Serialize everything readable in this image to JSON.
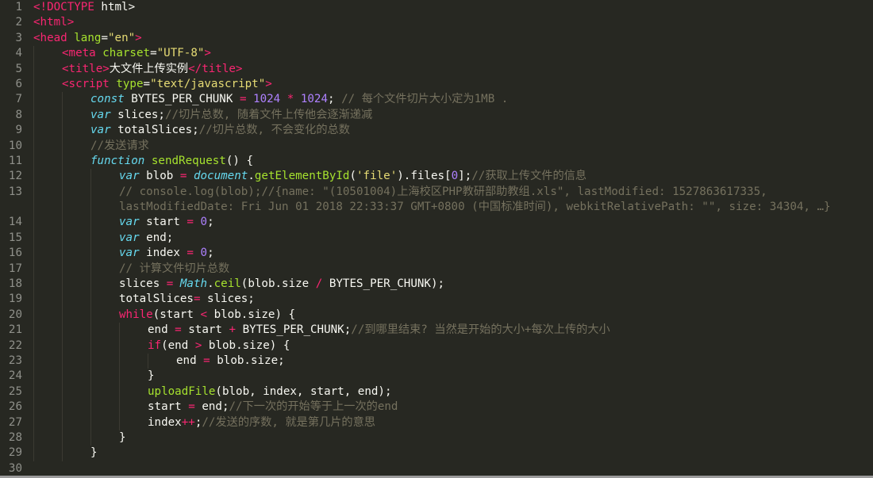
{
  "editor": {
    "lines": [
      {
        "n": "1",
        "indent": 0,
        "t": [
          [
            "tag",
            "<!DOCTYPE"
          ],
          [
            "plain",
            " html>"
          ]
        ]
      },
      {
        "n": "2",
        "indent": 0,
        "t": [
          [
            "tag",
            "<html>"
          ]
        ]
      },
      {
        "n": "3",
        "indent": 0,
        "t": [
          [
            "tag",
            "<head"
          ],
          [
            "attr",
            " lang"
          ],
          [
            "plain",
            "="
          ],
          [
            "str",
            "\"en\""
          ],
          [
            "tag",
            ">"
          ]
        ]
      },
      {
        "n": "4",
        "indent": 1,
        "t": [
          [
            "tag",
            "<meta"
          ],
          [
            "attr",
            " charset"
          ],
          [
            "plain",
            "="
          ],
          [
            "str",
            "\"UTF-8\""
          ],
          [
            "tag",
            ">"
          ]
        ]
      },
      {
        "n": "5",
        "indent": 1,
        "t": [
          [
            "tag",
            "<title>"
          ],
          [
            "plain",
            "大文件上传实例"
          ],
          [
            "tag",
            "</title>"
          ]
        ]
      },
      {
        "n": "6",
        "indent": 1,
        "t": [
          [
            "tag",
            "<script"
          ],
          [
            "attr",
            " type"
          ],
          [
            "plain",
            "="
          ],
          [
            "str",
            "\"text/javascript\""
          ],
          [
            "tag",
            ">"
          ]
        ]
      },
      {
        "n": "7",
        "indent": 2,
        "t": [
          [
            "kw",
            "const"
          ],
          [
            "plain",
            " BYTES_PER_CHUNK "
          ],
          [
            "op",
            "="
          ],
          [
            "plain",
            " "
          ],
          [
            "num",
            "1024"
          ],
          [
            "plain",
            " "
          ],
          [
            "op",
            "*"
          ],
          [
            "plain",
            " "
          ],
          [
            "num",
            "1024"
          ],
          [
            "plain",
            "; "
          ],
          [
            "cmt",
            "// 每个文件切片大小定为1MB ."
          ]
        ]
      },
      {
        "n": "8",
        "indent": 2,
        "t": [
          [
            "kw",
            "var"
          ],
          [
            "plain",
            " slices;"
          ],
          [
            "cmt",
            "//切片总数, 随着文件上传他会逐渐递减"
          ]
        ]
      },
      {
        "n": "9",
        "indent": 2,
        "t": [
          [
            "kw",
            "var"
          ],
          [
            "plain",
            " totalSlices;"
          ],
          [
            "cmt",
            "//切片总数, 不会变化的总数"
          ]
        ]
      },
      {
        "n": "10",
        "indent": 2,
        "t": [
          [
            "cmt",
            "//发送请求"
          ]
        ]
      },
      {
        "n": "11",
        "indent": 2,
        "t": [
          [
            "kw",
            "function"
          ],
          [
            "plain",
            " "
          ],
          [
            "fn",
            "sendRequest"
          ],
          [
            "plain",
            "() {"
          ]
        ]
      },
      {
        "n": "12",
        "indent": 3,
        "t": [
          [
            "kw",
            "var"
          ],
          [
            "plain",
            " blob "
          ],
          [
            "op",
            "="
          ],
          [
            "plain",
            " "
          ],
          [
            "kw",
            "document"
          ],
          [
            "plain",
            "."
          ],
          [
            "fn",
            "getElementById"
          ],
          [
            "plain",
            "("
          ],
          [
            "str",
            "'file'"
          ],
          [
            "plain",
            ").files["
          ],
          [
            "num",
            "0"
          ],
          [
            "plain",
            "];"
          ],
          [
            "cmt",
            "//获取上传文件的信息"
          ]
        ]
      },
      {
        "n": "13",
        "indent": 3,
        "tall": true,
        "t": [
          [
            "cmt",
            "// console.log(blob);//{name: \"(10501004)上海校区PHP教研部助教组.xls\", lastModified: 1527863617335, lastModifiedDate: Fri Jun 01 2018 22:33:37 GMT+0800 (中国标准时间), webkitRelativePath: \"\", size: 34304, …}"
          ]
        ]
      },
      {
        "n": "14",
        "indent": 3,
        "t": [
          [
            "kw",
            "var"
          ],
          [
            "plain",
            " start "
          ],
          [
            "op",
            "="
          ],
          [
            "plain",
            " "
          ],
          [
            "num",
            "0"
          ],
          [
            "plain",
            ";"
          ]
        ]
      },
      {
        "n": "15",
        "indent": 3,
        "t": [
          [
            "kw",
            "var"
          ],
          [
            "plain",
            " end;"
          ]
        ]
      },
      {
        "n": "16",
        "indent": 3,
        "t": [
          [
            "kw",
            "var"
          ],
          [
            "plain",
            " index "
          ],
          [
            "op",
            "="
          ],
          [
            "plain",
            " "
          ],
          [
            "num",
            "0"
          ],
          [
            "plain",
            ";"
          ]
        ]
      },
      {
        "n": "17",
        "indent": 3,
        "t": [
          [
            "cmt",
            "// 计算文件切片总数"
          ]
        ]
      },
      {
        "n": "18",
        "indent": 3,
        "t": [
          [
            "plain",
            "slices "
          ],
          [
            "op",
            "="
          ],
          [
            "plain",
            " "
          ],
          [
            "kw",
            "Math"
          ],
          [
            "plain",
            "."
          ],
          [
            "fn",
            "ceil"
          ],
          [
            "plain",
            "(blob.size "
          ],
          [
            "op",
            "/"
          ],
          [
            "plain",
            " BYTES_PER_CHUNK);"
          ]
        ]
      },
      {
        "n": "19",
        "indent": 3,
        "t": [
          [
            "plain",
            "totalSlices"
          ],
          [
            "op",
            "="
          ],
          [
            "plain",
            " slices;"
          ]
        ]
      },
      {
        "n": "20",
        "indent": 3,
        "t": [
          [
            "op",
            "while"
          ],
          [
            "plain",
            "(start "
          ],
          [
            "op",
            "<"
          ],
          [
            "plain",
            " blob.size) {"
          ]
        ]
      },
      {
        "n": "21",
        "indent": 4,
        "t": [
          [
            "plain",
            "end "
          ],
          [
            "op",
            "="
          ],
          [
            "plain",
            " start "
          ],
          [
            "op",
            "+"
          ],
          [
            "plain",
            " BYTES_PER_CHUNK;"
          ],
          [
            "cmt",
            "//到哪里结束? 当然是开始的大小+每次上传的大小"
          ]
        ]
      },
      {
        "n": "22",
        "indent": 4,
        "t": [
          [
            "op",
            "if"
          ],
          [
            "plain",
            "(end "
          ],
          [
            "op",
            ">"
          ],
          [
            "plain",
            " blob.size) {"
          ]
        ]
      },
      {
        "n": "23",
        "indent": 5,
        "t": [
          [
            "plain",
            "end "
          ],
          [
            "op",
            "="
          ],
          [
            "plain",
            " blob.size;"
          ]
        ]
      },
      {
        "n": "24",
        "indent": 4,
        "t": [
          [
            "plain",
            "}"
          ]
        ]
      },
      {
        "n": "25",
        "indent": 4,
        "t": [
          [
            "fn",
            "uploadFile"
          ],
          [
            "plain",
            "(blob, index, start, end);"
          ]
        ]
      },
      {
        "n": "26",
        "indent": 4,
        "t": [
          [
            "plain",
            "start "
          ],
          [
            "op",
            "="
          ],
          [
            "plain",
            " end;"
          ],
          [
            "cmt",
            "//下一次的开始等于上一次的end"
          ]
        ]
      },
      {
        "n": "27",
        "indent": 4,
        "t": [
          [
            "plain",
            "index"
          ],
          [
            "op",
            "++"
          ],
          [
            "plain",
            ";"
          ],
          [
            "cmt",
            "//发送的序数, 就是第几片的意思"
          ]
        ]
      },
      {
        "n": "28",
        "indent": 3,
        "t": [
          [
            "plain",
            "}"
          ]
        ]
      },
      {
        "n": "29",
        "indent": 2,
        "t": [
          [
            "plain",
            "}"
          ]
        ]
      },
      {
        "n": "30",
        "indent": 0,
        "t": []
      }
    ]
  },
  "theme": {
    "background": "#272822",
    "tag": "#f92672",
    "keyword": "#66d9ef",
    "string": "#e6db74",
    "number": "#ae81ff",
    "function": "#a6e22e",
    "comment": "#75715e",
    "gutter": "#8f908a"
  }
}
